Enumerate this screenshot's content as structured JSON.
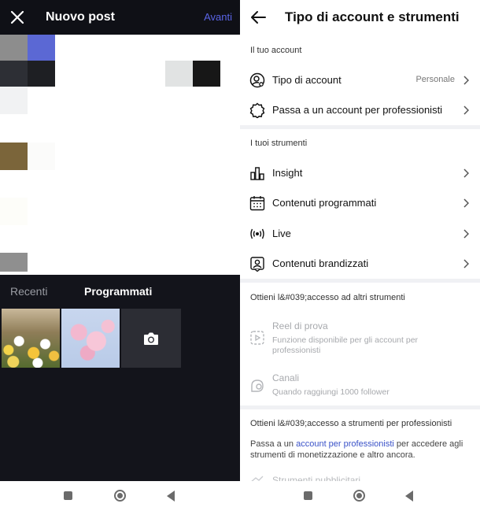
{
  "left": {
    "title": "Nuovo post",
    "next_label": "Avanti",
    "tabs": {
      "recent": "Recenti",
      "scheduled": "Programmati"
    }
  },
  "right": {
    "title": "Tipo di account e strumenti",
    "section_account": "Il tuo account",
    "account_type_label": "Tipo di account",
    "account_type_value": "Personale",
    "switch_pro_label": "Passa a un account per professionisti",
    "section_tools": "I tuoi strumenti",
    "tools": [
      {
        "label": "Insight"
      },
      {
        "label": "Contenuti programmati"
      },
      {
        "label": "Live"
      },
      {
        "label": "Contenuti brandizzati"
      }
    ],
    "section_other": "Ottieni l&#039;accesso ad altri strumenti",
    "reel_label": "Reel di prova",
    "reel_sub": "Funzione disponibile per gli account per professionisti",
    "channels_label": "Canali",
    "channels_sub": "Quando raggiungi 1000 follower",
    "section_pro": "Ottieni l&#039;accesso a strumenti per professionisti",
    "pro_text_before": "Passa a un ",
    "pro_link": "account per professionisti",
    "pro_text_after": " per accedere agli strumenti di monetizzazione e altro ancora.",
    "cut_label": "Strumenti pubblicitari"
  },
  "icons": {
    "close": "close-icon",
    "camera": "camera-icon",
    "back": "arrow-left-icon",
    "chevron": "chevron-right-icon"
  },
  "colors": {
    "accent": "#5a64e6",
    "link": "#3a52c8",
    "dark_bg": "#13141b"
  }
}
